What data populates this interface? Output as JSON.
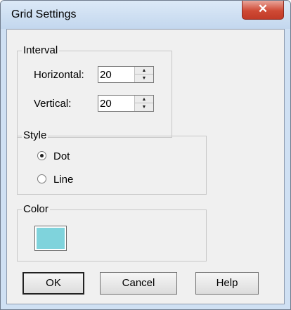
{
  "window": {
    "title": "Grid Settings",
    "close_glyph": "✕"
  },
  "interval": {
    "legend": "Interval",
    "horizontal_label": "Horizontal:",
    "horizontal_value": "20",
    "vertical_label": "Vertical:",
    "vertical_value": "20"
  },
  "style": {
    "legend": "Style",
    "options": [
      {
        "label": "Dot",
        "selected": true
      },
      {
        "label": "Line",
        "selected": false
      }
    ]
  },
  "color": {
    "legend": "Color",
    "value": "#7fd3dc"
  },
  "buttons": {
    "ok": "OK",
    "cancel": "Cancel",
    "help": "Help"
  },
  "icons": {
    "spin_up": "up-arrow-icon",
    "spin_down": "down-arrow-icon",
    "close": "close-icon"
  }
}
